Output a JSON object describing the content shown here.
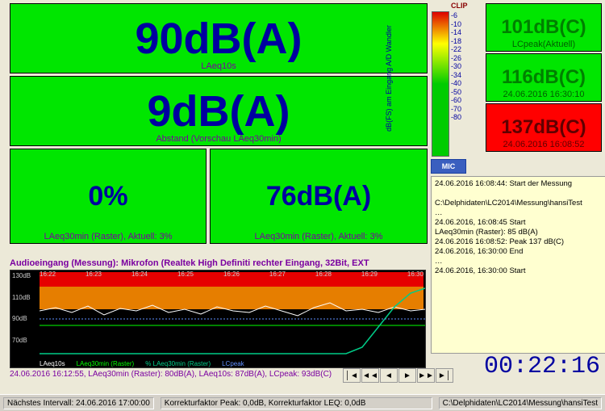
{
  "main": {
    "laeq10s": {
      "value": "90dB(A)",
      "label": "LAeq10s"
    },
    "abstand": {
      "value": "9dB(A)",
      "label": "Abstand (Vorschau LAeq30min)"
    },
    "pct": {
      "value": "0%",
      "label": "LAeq30min (Raster), Aktuell: 3%"
    },
    "laeq30": {
      "value": "76dB(A)",
      "label": "LAeq30min (Raster), Aktuell: 3%"
    }
  },
  "side": {
    "lcpeak": {
      "value": "101dB(C)",
      "label": "LCpeak(Aktuell)"
    },
    "midgreen": {
      "value": "116dB(C)",
      "label": "24.06.2016 16:30:10"
    },
    "red": {
      "value": "137dB(C)",
      "label": "24.06.2016 16:08:52"
    }
  },
  "meter": {
    "clip": "CLIP",
    "ticks": [
      "-6",
      "-10",
      "-14",
      "-18",
      "-22",
      "-26",
      "-30",
      "-34",
      "-40",
      "-50",
      "-60",
      "-70",
      "-80"
    ],
    "axis": "dB(FS) am Eingang A/D Wandler",
    "mic": "MIC"
  },
  "log": [
    "24.06.2016 16:08:44: Start der Messung",
    "",
    "C:\\Delphidaten\\LC2014\\Messung\\hansiTest",
    "…",
    "24.06.2016, 16:08:45 Start",
    "LAeq30min (Raster): 85 dB(A)",
    "24.06.2016 16:08:52: Peak 137 dB(C)",
    "24.06.2016, 16:30:00 End",
    "…",
    "24.06.2016, 16:30:00 Start"
  ],
  "graph": {
    "title": "Audioeingang (Messung): Mikrofon (Realtek High Definiti  rechter Eingang, 32Bit, EXT",
    "xticks": [
      "16:22",
      "16:23",
      "16:24",
      "16:25",
      "16:26",
      "16:27",
      "16:28",
      "16:29",
      "16:30"
    ],
    "yticks": [
      "130dB",
      "110dB",
      "90dB",
      "70dB",
      ""
    ],
    "legend": [
      "LAeq10s",
      "LAeq30min (Raster)",
      "% LAeq30min (Raster)",
      "LCpeak"
    ],
    "status": "24.06.2016 16:12:55, LAeq30min (Raster): 80dB(A), LAeq10s: 87dB(A), LCpeak: 93dB(C)"
  },
  "timer": "00:22:16",
  "footer": {
    "next": "Nächstes Intervall: 24.06.2016 17:00:00",
    "korr": "Korrekturfaktor Peak: 0,0dB, Korrekturfaktor LEQ: 0,0dB",
    "path": "C:\\Delphidaten\\LC2014\\Messung\\hansiTest"
  },
  "chart_data": {
    "type": "line",
    "x_categories": [
      "16:22",
      "16:23",
      "16:24",
      "16:25",
      "16:26",
      "16:27",
      "16:28",
      "16:29",
      "16:30"
    ],
    "ylim": [
      50,
      130
    ],
    "ylabel": "dB",
    "series": [
      {
        "name": "LAeq10s",
        "color": "#ffffff",
        "approx_range": [
          85,
          115
        ]
      },
      {
        "name": "LAeq30min (Raster)",
        "color": "#00ff00",
        "approx_value": 80
      },
      {
        "name": "% LAeq30min (Raster)",
        "color": "#008080",
        "approx_range": [
          0,
          3
        ],
        "unit": "%"
      },
      {
        "name": "LCpeak",
        "color": "#6090ff",
        "approx_value": 93
      }
    ],
    "threshold_band": {
      "from": 100,
      "to": 130,
      "color": "#ff8c00"
    },
    "threshold_line": {
      "at": 130,
      "color": "#ff0000"
    }
  }
}
